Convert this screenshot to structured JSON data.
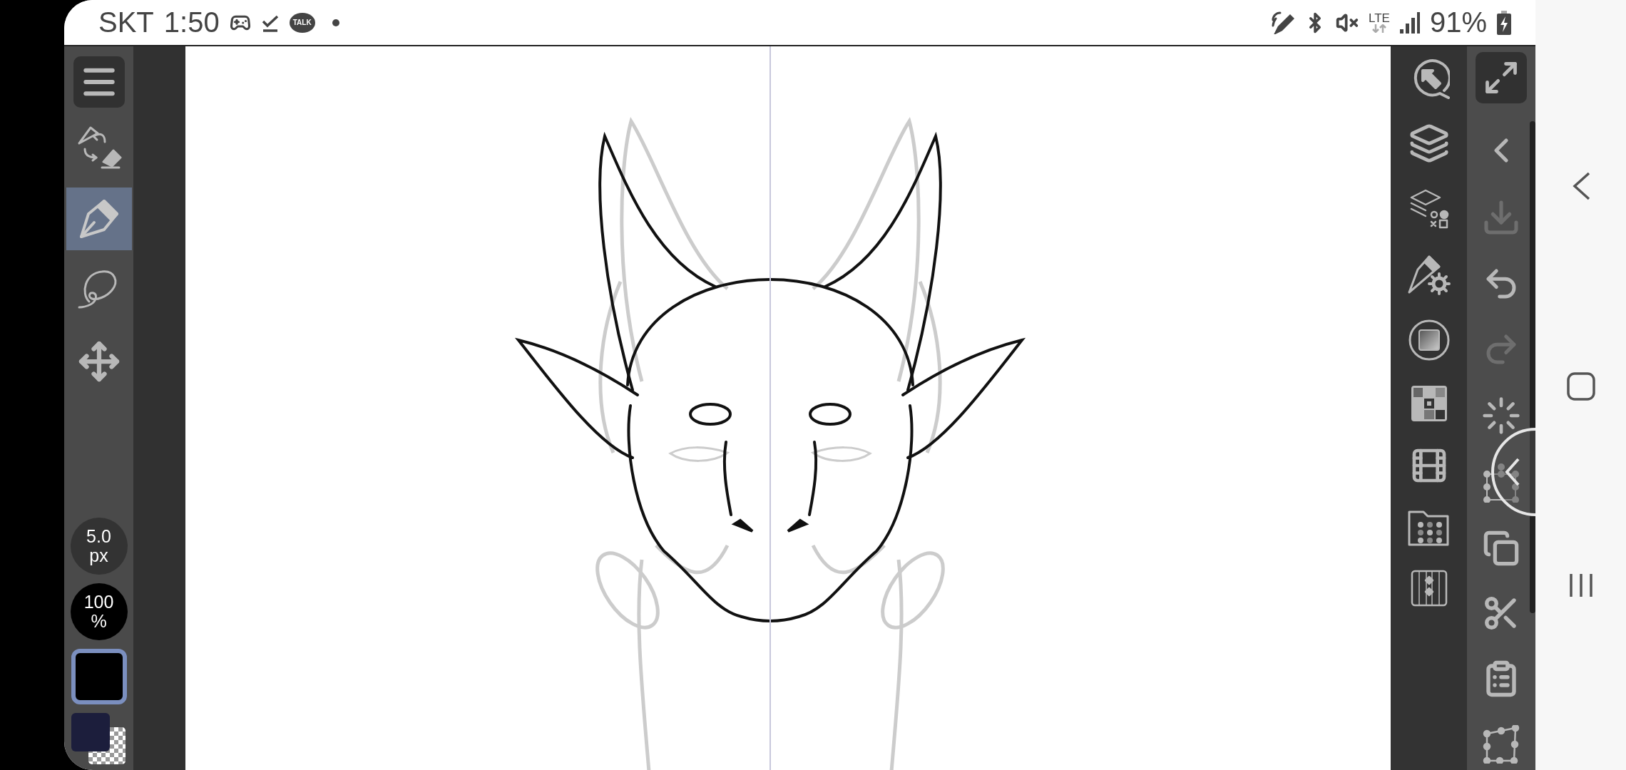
{
  "status_bar": {
    "carrier": "SKT",
    "time": "1:50",
    "notifications": [
      {
        "kind": "game"
      },
      {
        "kind": "download"
      },
      {
        "kind": "talk",
        "label": "TALK"
      },
      {
        "kind": "dot"
      }
    ],
    "system_icons": [
      {
        "kind": "pen"
      },
      {
        "kind": "bluetooth"
      },
      {
        "kind": "mute"
      }
    ],
    "network": "LTE",
    "battery": "91%"
  },
  "left_toolbar": {
    "tools": [
      {
        "kind": "swap",
        "selected": false
      },
      {
        "kind": "pen",
        "selected": true
      },
      {
        "kind": "lasso",
        "selected": false
      },
      {
        "kind": "move",
        "selected": false
      }
    ],
    "brush_size": {
      "value": "5.0",
      "unit": "px"
    },
    "opacity": {
      "value": "100",
      "unit": "%"
    },
    "colors": [
      {
        "kind": "main",
        "color": "#000000",
        "selected": true
      },
      {
        "kind": "sub",
        "color": "#1c1e3c",
        "selected": false
      }
    ]
  },
  "right_panel": {
    "tools": [
      {
        "kind": "navigator"
      },
      {
        "kind": "layers"
      },
      {
        "kind": "layer-props"
      },
      {
        "kind": "brush-settings"
      },
      {
        "kind": "material"
      },
      {
        "kind": "tile"
      },
      {
        "kind": "film"
      },
      {
        "kind": "folder"
      },
      {
        "kind": "timeline"
      }
    ],
    "commands": [
      {
        "kind": "fullscreen",
        "disabled": false
      },
      {
        "kind": "back",
        "disabled": false
      },
      {
        "kind": "import",
        "disabled": true
      },
      {
        "kind": "undo",
        "disabled": false
      },
      {
        "kind": "redo",
        "disabled": true
      },
      {
        "kind": "spinner",
        "disabled": false
      },
      {
        "kind": "transform",
        "disabled": false
      },
      {
        "kind": "copy",
        "disabled": false
      },
      {
        "kind": "cut",
        "disabled": false
      },
      {
        "kind": "paste",
        "disabled": false
      },
      {
        "kind": "distort",
        "disabled": false
      }
    ]
  },
  "nav_bar": {
    "buttons": [
      {
        "kind": "back"
      },
      {
        "kind": "home"
      },
      {
        "kind": "recents"
      }
    ]
  }
}
